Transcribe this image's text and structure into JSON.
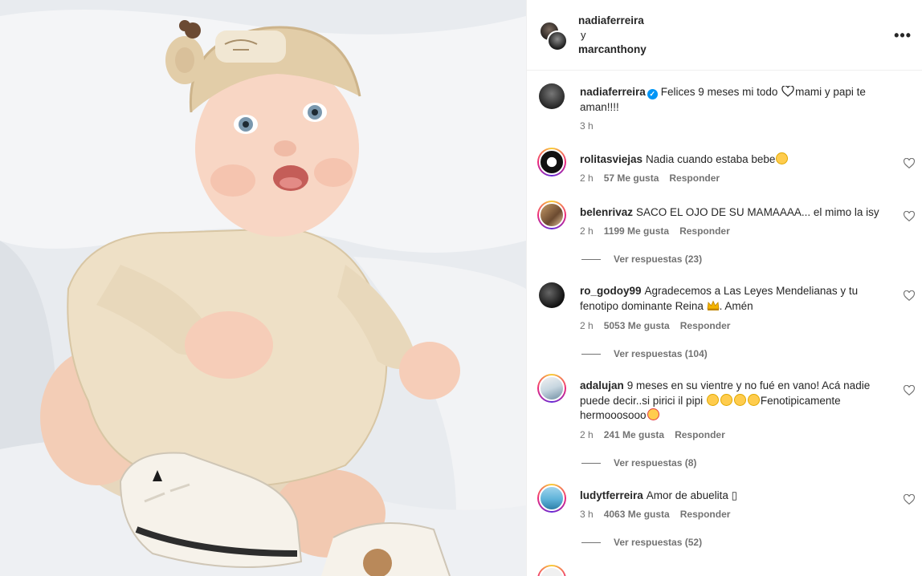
{
  "post": {
    "collab_user_1": "nadiaferreira",
    "collab_joiner": "y",
    "collab_user_2": "marcanthony",
    "more_label": "•••",
    "caption": {
      "username": "nadiaferreira",
      "text_1": "Felices 9 meses mi todo",
      "text_2": "mami y papi te aman!!!!",
      "time": "3 h"
    }
  },
  "comments": [
    {
      "username": "rolitasviejas",
      "text": "Nadia cuando estaba bebe",
      "time": "2 h",
      "likes": "57 Me gusta",
      "reply": "Responder",
      "replies": ""
    },
    {
      "username": "belenrivaz",
      "text": "SACO EL OJO DE SU MAMAAAA... el mimo la isy",
      "time": "2 h",
      "likes": "1199 Me gusta",
      "reply": "Responder",
      "replies": "Ver respuestas (23)"
    },
    {
      "username": "ro_godoy99",
      "text": "Agradecemos a Las Leyes Mendelianas y tu fenotipo dominante Reina",
      "text_after": ". Amén",
      "time": "2 h",
      "likes": "5053 Me gusta",
      "reply": "Responder",
      "replies": "Ver respuestas (104)"
    },
    {
      "username": "adalujan",
      "text": "9 meses en su vientre y no fué en vano! Acá nadie puede decir..si pirici il pipi",
      "text_after": "Fenotipicamente hermooosooo",
      "time": "2 h",
      "likes": "241 Me gusta",
      "reply": "Responder",
      "replies": "Ver respuestas (8)"
    },
    {
      "username": "ludytferreira",
      "text": "Amor de abuelita",
      "text_after": "▯",
      "time": "3 h",
      "likes": "4063 Me gusta",
      "reply": "Responder",
      "replies": "Ver respuestas (52)"
    }
  ],
  "icons": {
    "more": "more-horizontal-icon",
    "like": "heart-outline-icon",
    "verified": "verified-badge-icon"
  },
  "colors": {
    "verified": "#0095f6",
    "muted_text": "#737373",
    "text": "#262626"
  }
}
